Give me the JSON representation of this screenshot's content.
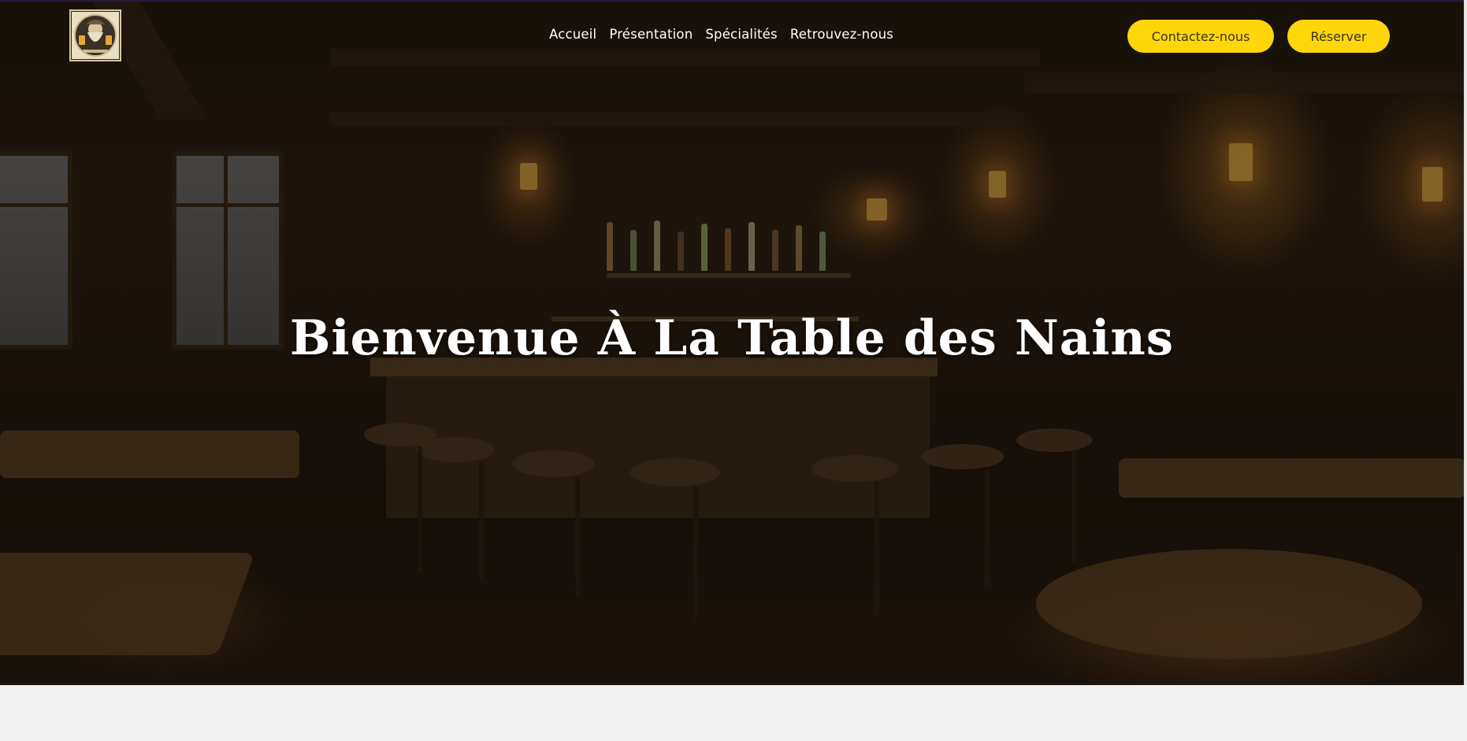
{
  "header": {
    "logo_icon": "dwarf-tavern-logo",
    "nav": [
      {
        "label": "Accueil"
      },
      {
        "label": "Présentation"
      },
      {
        "label": "Spécialités"
      },
      {
        "label": "Retrouvez-nous"
      }
    ],
    "contact_label": "Contactez-nous",
    "reserve_label": "Réserver"
  },
  "hero": {
    "title": "Bienvenue À La Table des Nains",
    "background": "dim-tavern-bar-photo"
  },
  "colors": {
    "accent": "#ffd60a",
    "title": "#ffffff",
    "page_bg": "#f1f1f1"
  }
}
